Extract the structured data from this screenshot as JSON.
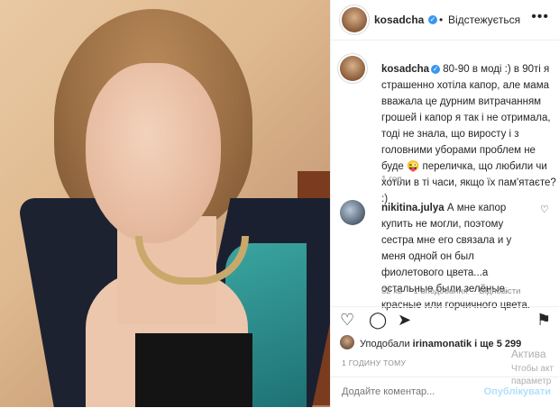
{
  "header": {
    "username": "kosadcha",
    "separator": "•",
    "following": "Відстежується",
    "more": "•••"
  },
  "caption": {
    "username": "kosadcha",
    "text": "80-90 в моді :) в 90ті я страшенно хотіла капор, але мама вважала це дурним витрачанням грошей і капор я так і не отримала, тоді не знала, що виросту і з головними уборами проблем не буде 😜 переличка, що любили чи хотіли в ті часи, якщо їх пам'ятаєте? :)",
    "time": "1 год"
  },
  "comment": {
    "username": "nikitina.julya",
    "text": "А мне капор купить не могли, поэтому сестра мне его связала и у меня одной он был фиолетового цвета...а остальные были зелёные, красные или горчичного цвета.",
    "time": "52 хв",
    "likes": "1 вподобання",
    "reply": "Відповісти"
  },
  "likes": {
    "prefix": "Уподобали",
    "user": "irinamonatik",
    "rest": "і ще 5 299"
  },
  "posted_ago": "1 ГОДИНУ ТОМУ",
  "comment_box": {
    "placeholder": "Додайте коментар...",
    "post": "Опублікувати"
  },
  "watermark": {
    "line1": "Актива",
    "line2": "Чтобы акт",
    "line3": "параметр"
  },
  "colors": {
    "link": "#3897f0",
    "muted": "#8e8e8e"
  }
}
